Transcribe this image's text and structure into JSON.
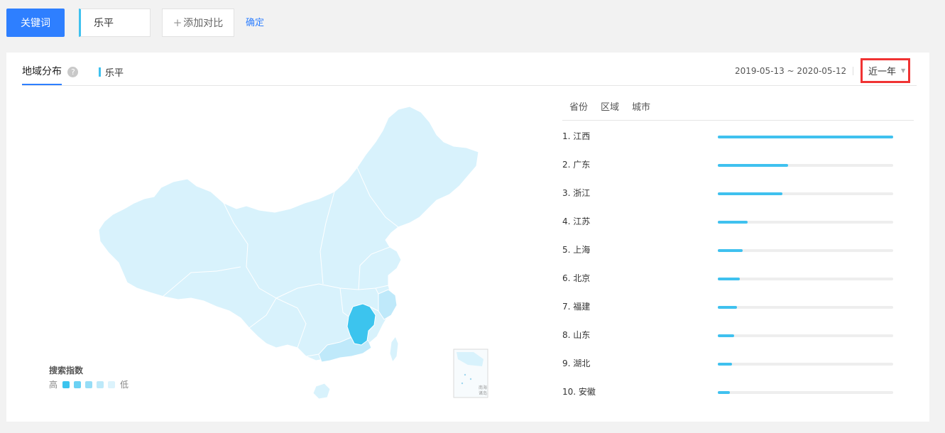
{
  "toolbar": {
    "keyword_button": "关键词",
    "keyword_value": "乐平",
    "add_compare": "添加对比",
    "confirm": "确定"
  },
  "panel": {
    "tab_region": "地域分布",
    "help_mark": "?",
    "legend_keyword": "乐平",
    "date_range": "2019-05-13 ~ 2020-05-12",
    "period_selected": "近一年"
  },
  "map": {
    "legend_title": "搜索指数",
    "legend_high": "高",
    "legend_low": "低",
    "legend_colors": [
      "#3cc4ee",
      "#6bd1f3",
      "#96ddf6",
      "#bde9f9",
      "#dcf3fc"
    ],
    "south_sea_label_1": "南海",
    "south_sea_label_2": "诸岛",
    "highlight_color": "#3cc4ee",
    "medium_color": "#bfe9fa",
    "base_color": "#d8f2fc"
  },
  "ranking": {
    "tabs": [
      "省份",
      "区域",
      "城市"
    ],
    "items": [
      {
        "label": "1.  江西",
        "value": 1.0
      },
      {
        "label": "2.  广东",
        "value": 0.4
      },
      {
        "label": "3.  浙江",
        "value": 0.37
      },
      {
        "label": "4.  江苏",
        "value": 0.17
      },
      {
        "label": "5.  上海",
        "value": 0.14
      },
      {
        "label": "6.  北京",
        "value": 0.125
      },
      {
        "label": "7.  福建",
        "value": 0.11
      },
      {
        "label": "8.  山东",
        "value": 0.095
      },
      {
        "label": "9.  湖北",
        "value": 0.08
      },
      {
        "label": "10. 安徽",
        "value": 0.07
      }
    ]
  }
}
